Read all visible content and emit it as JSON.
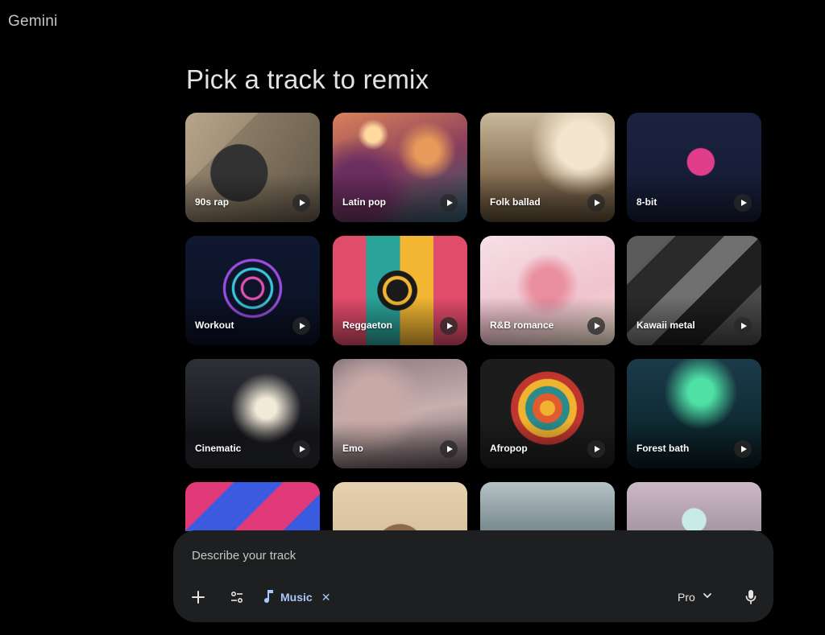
{
  "app": {
    "title": "Gemini"
  },
  "heading": "Pick a track to remix",
  "tracks": [
    {
      "label": "90s rap"
    },
    {
      "label": "Latin pop"
    },
    {
      "label": "Folk ballad"
    },
    {
      "label": "8-bit"
    },
    {
      "label": "Workout"
    },
    {
      "label": "Reggaeton"
    },
    {
      "label": "R&B romance"
    },
    {
      "label": "Kawaii metal"
    },
    {
      "label": "Cinematic"
    },
    {
      "label": "Emo"
    },
    {
      "label": "Afropop"
    },
    {
      "label": "Forest bath"
    }
  ],
  "prompt": {
    "placeholder": "Describe your track",
    "chip_label": "Music",
    "model": "Pro"
  },
  "icons": {
    "add": "plus-icon",
    "tools": "sliders-icon",
    "chip": "music-note-icon",
    "chip_remove": "close-icon",
    "model_dropdown": "chevron-down-icon",
    "voice": "mic-icon",
    "play": "play-icon"
  },
  "colors": {
    "background": "#000000",
    "prompt_bg": "#1e1f20",
    "accent": "#a8c7fa",
    "text": "#e3e3e3"
  }
}
